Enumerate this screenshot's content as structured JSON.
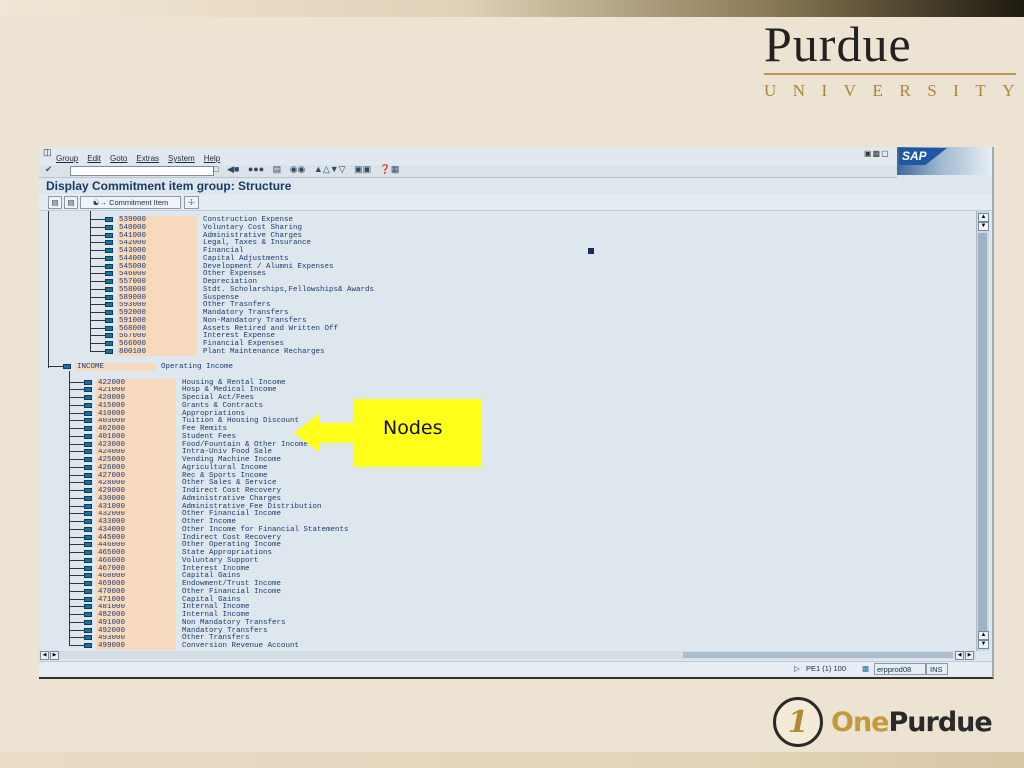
{
  "slide": {
    "logo_top": {
      "word": "Purdue",
      "subtitle": "UNIVERSITY"
    },
    "logo_bottom": {
      "one": "One",
      "purdue": "Purdue"
    }
  },
  "sap": {
    "menu": [
      "Group",
      "Edit",
      "Goto",
      "Extras",
      "System",
      "Help"
    ],
    "logo_text": "SAP",
    "title": "Display Commitment item group: Structure",
    "app_button_label": "Commitment Item",
    "status": {
      "session": "PE1 (1) 100",
      "server": "erpprod08",
      "mode": "INS"
    }
  },
  "tree": {
    "upper_items": [
      {
        "code": "539000",
        "desc": "Construction Expense"
      },
      {
        "code": "540000",
        "desc": "Voluntary Cost Sharing"
      },
      {
        "code": "541000",
        "desc": "Administrative Charges"
      },
      {
        "code": "542000",
        "desc": "Legal, Taxes & Insurance"
      },
      {
        "code": "543000",
        "desc": "Financial"
      },
      {
        "code": "544000",
        "desc": "Capital Adjustments"
      },
      {
        "code": "545000",
        "desc": "Development / Alumni Expenses"
      },
      {
        "code": "546000",
        "desc": "Other Expenses"
      },
      {
        "code": "557000",
        "desc": "Depreciation"
      },
      {
        "code": "558000",
        "desc": "Stdt. Scholarships,Fellowships& Awards"
      },
      {
        "code": "589000",
        "desc": "Suspense"
      },
      {
        "code": "593000",
        "desc": "Other Trasnfers"
      },
      {
        "code": "592000",
        "desc": "Mandatory Transfers"
      },
      {
        "code": "591000",
        "desc": "Non-Mandatory Transfers"
      },
      {
        "code": "568000",
        "desc": "Assets Retired and Written Off"
      },
      {
        "code": "567000",
        "desc": "Interest Expense"
      },
      {
        "code": "566000",
        "desc": "Financial Expenses"
      },
      {
        "code": "800100",
        "desc": "Plant Maintenance Recharges"
      }
    ],
    "income_node": {
      "code": "INCOME",
      "desc": "Operating Income"
    },
    "income_items": [
      {
        "code": "422000",
        "desc": "Housing & Rental Income"
      },
      {
        "code": "421000",
        "desc": "Hosp & Medical Income"
      },
      {
        "code": "420000",
        "desc": "Special Act/Fees"
      },
      {
        "code": "415000",
        "desc": "Grants & Contracts"
      },
      {
        "code": "410000",
        "desc": "Appropriations"
      },
      {
        "code": "403000",
        "desc": "Tuition & Housing Discount"
      },
      {
        "code": "402000",
        "desc": "Fee Remits"
      },
      {
        "code": "401000",
        "desc": "Student Fees"
      },
      {
        "code": "423000",
        "desc": "Food/Fountain & Other Income"
      },
      {
        "code": "424000",
        "desc": "Intra-Univ Food Sale"
      },
      {
        "code": "425000",
        "desc": "Vending Machine Income"
      },
      {
        "code": "426000",
        "desc": "Agricultural Income"
      },
      {
        "code": "427000",
        "desc": "Rec & Sports Income"
      },
      {
        "code": "428000",
        "desc": "Other Sales & Service"
      },
      {
        "code": "429000",
        "desc": "Indirect Cost Recovery"
      },
      {
        "code": "430000",
        "desc": "Administrative Charges"
      },
      {
        "code": "431000",
        "desc": "Administrative Fee Distribution"
      },
      {
        "code": "432000",
        "desc": "Other Financial Income"
      },
      {
        "code": "433000",
        "desc": "Other Income"
      },
      {
        "code": "434000",
        "desc": "Other Income for Financial Statements"
      },
      {
        "code": "445000",
        "desc": "Indirect Cost Recovery"
      },
      {
        "code": "446000",
        "desc": "Other Operating Income"
      },
      {
        "code": "465000",
        "desc": "State Appropriations"
      },
      {
        "code": "466000",
        "desc": "Voluntary Support"
      },
      {
        "code": "467000",
        "desc": "Interest Income"
      },
      {
        "code": "468000",
        "desc": "Capital Gains"
      },
      {
        "code": "469000",
        "desc": "Endowment/Trust Income"
      },
      {
        "code": "470000",
        "desc": "Other Financial Income"
      },
      {
        "code": "471000",
        "desc": "Capital Gains"
      },
      {
        "code": "481000",
        "desc": "Internal Income"
      },
      {
        "code": "482000",
        "desc": "Internal Income"
      },
      {
        "code": "491000",
        "desc": "Non Mandatory Transfers"
      },
      {
        "code": "492000",
        "desc": "Mandatory Transfers"
      },
      {
        "code": "493000",
        "desc": "Other Transfers"
      },
      {
        "code": "499000",
        "desc": "Conversion Revenue Account"
      }
    ]
  },
  "callout": {
    "label": "Nodes",
    "color": "#ffff1a"
  }
}
